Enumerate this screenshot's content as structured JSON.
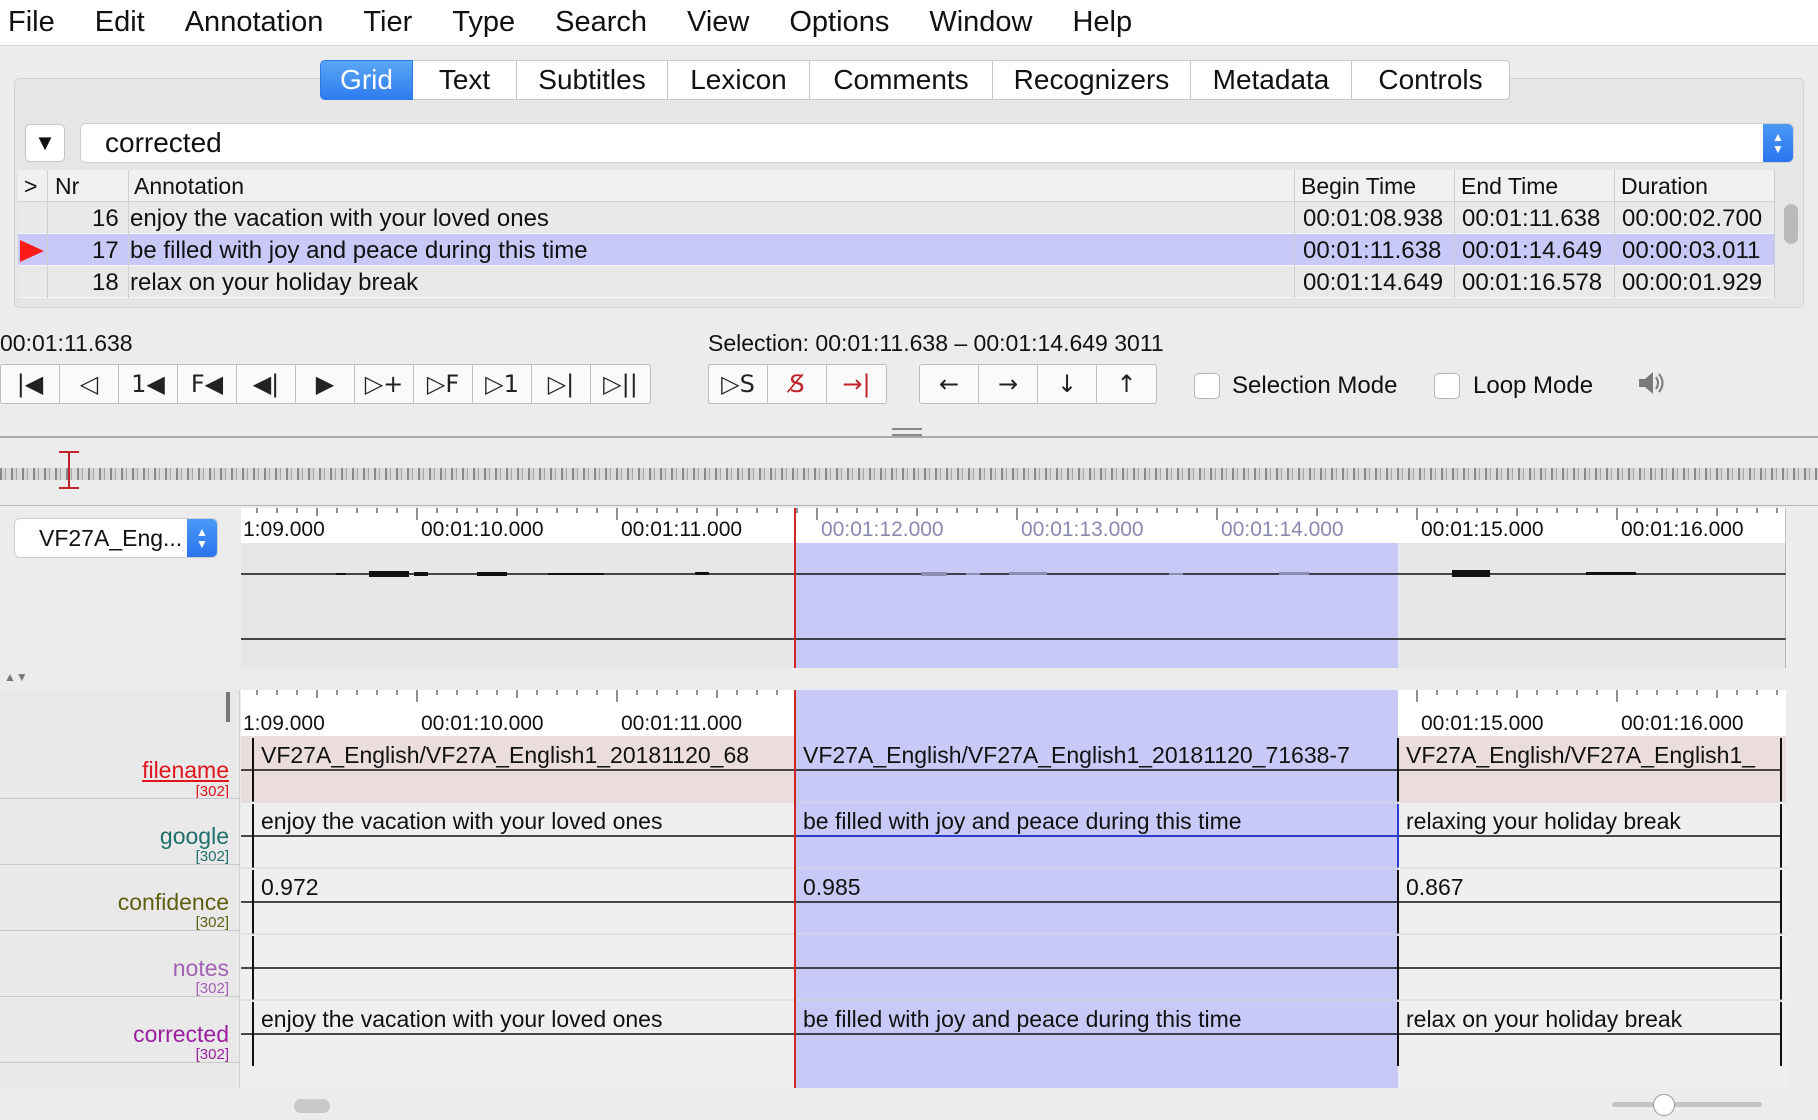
{
  "menu": [
    "File",
    "Edit",
    "Annotation",
    "Tier",
    "Type",
    "Search",
    "View",
    "Options",
    "Window",
    "Help"
  ],
  "tabs": [
    {
      "label": "Grid",
      "active": true
    },
    {
      "label": "Text"
    },
    {
      "label": "Subtitles"
    },
    {
      "label": "Lexicon"
    },
    {
      "label": "Comments"
    },
    {
      "label": "Recognizers"
    },
    {
      "label": "Metadata"
    },
    {
      "label": "Controls"
    }
  ],
  "grid": {
    "tier_selected": "corrected",
    "columns": {
      "arrow": ">",
      "nr": "Nr",
      "annotation": "Annotation",
      "begin": "Begin Time",
      "end": "End Time",
      "duration": "Duration"
    },
    "rows": [
      {
        "nr": "16",
        "annotation": "enjoy the vacation with your loved ones",
        "begin": "00:01:08.938",
        "end": "00:01:11.638",
        "duration": "00:00:02.700",
        "selected": false
      },
      {
        "nr": "17",
        "annotation": "be filled with joy and peace during this time",
        "begin": "00:01:11.638",
        "end": "00:01:14.649",
        "duration": "00:00:03.011",
        "selected": true
      },
      {
        "nr": "18",
        "annotation": "relax on your holiday break",
        "begin": "00:01:14.649",
        "end": "00:01:16.578",
        "duration": "00:00:01.929",
        "selected": false
      }
    ]
  },
  "media": {
    "current_time": "00:01:11.638",
    "selection": "Selection: 00:01:11.638 – 00:01:14.649  3011",
    "selection_mode_label": "Selection Mode",
    "loop_mode_label": "Loop Mode",
    "selection_mode": false,
    "loop_mode": false
  },
  "transport_buttons": [
    "|◀",
    "◁",
    "1◀",
    "F◀",
    "◀|",
    "▶",
    "▷+",
    "▷F",
    "▷1",
    "▷|",
    "▷||"
  ],
  "selection_buttons": [
    "▷S",
    "S̸",
    "→|"
  ],
  "nav_buttons": [
    "←",
    "→",
    "↓",
    "↑"
  ],
  "waveform": {
    "tier_combo": "VF27A_Eng...",
    "ticks": [
      "1:09.000",
      "00:01:10.000",
      "00:01:11.000",
      "00:01:12.000",
      "00:01:13.000",
      "00:01:14.000",
      "00:01:15.000",
      "00:01:16.000"
    ]
  },
  "timeline": {
    "ticks": [
      "1:09.000",
      "00:01:10.000",
      "00:01:11.000",
      "00:01:12.000",
      "00:01:13.000",
      "00:01:14.000",
      "00:01:15.000",
      "00:01:16.000"
    ],
    "tiers": [
      {
        "name": "filename",
        "count": "[302]",
        "color": "#e0141c",
        "underline": true,
        "cells": [
          "VF27A_English/VF27A_English1_20181120_68",
          "VF27A_English/VF27A_English1_20181120_71638-7",
          "VF27A_English/VF27A_English1_"
        ]
      },
      {
        "name": "google",
        "count": "[302]",
        "color": "#1f6f6c",
        "cells": [
          "enjoy the vacation with your loved ones",
          "be filled with joy and peace during this time",
          "relaxing your holiday break"
        ]
      },
      {
        "name": "confidence",
        "count": "[302]",
        "color": "#5f5f10",
        "cells": [
          "0.972",
          "0.985",
          "0.867"
        ]
      },
      {
        "name": "notes",
        "count": "[302]",
        "color": "#a462b4",
        "cells": [
          "",
          "",
          ""
        ]
      },
      {
        "name": "corrected",
        "count": "[302]",
        "color": "#9b1fa0",
        "cells": [
          "enjoy the vacation with your loved ones",
          "be filled with joy and peace during this time",
          "relax on your holiday break"
        ]
      }
    ]
  },
  "colors": {
    "selection": "#c9c9f8",
    "crosshair": "#d0262a",
    "accent": "#2e7cf0"
  }
}
